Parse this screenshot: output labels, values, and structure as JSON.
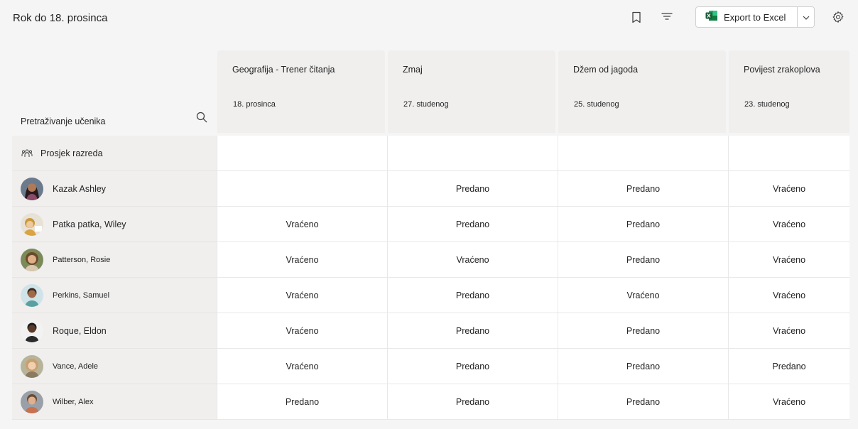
{
  "page": {
    "title": "Rok do 18. prosinca"
  },
  "toolbar": {
    "bookmark_icon": "bookmark-icon",
    "filter_icon": "filter-icon",
    "export_label": "Export to Excel",
    "excel_icon": "excel-icon",
    "dropdown_icon": "chevron-down-icon",
    "settings_icon": "gear-icon"
  },
  "search": {
    "label": "Pretraživanje učenika",
    "icon": "search-icon"
  },
  "assignments": [
    {
      "title": "Geografija - Trener čitanja",
      "date": "18. prosinca"
    },
    {
      "title": "Zmaj",
      "date": "27. studenog"
    },
    {
      "title": "Džem od jagoda",
      "date": "25. studenog"
    },
    {
      "title": "Povijest zrakoplova",
      "date": "23. studenog"
    }
  ],
  "class_average": {
    "label": "Prosjek razreda",
    "icon": "people-icon",
    "values": [
      "",
      "",
      "",
      ""
    ]
  },
  "students": [
    {
      "name": "Kazak Ashley",
      "statuses": [
        "",
        "Predano",
        "Predano",
        "Vraćeno"
      ]
    },
    {
      "name": "Patka patka, Wiley",
      "statuses": [
        "Vraćeno",
        "Predano",
        "Predano",
        "Vraćeno"
      ]
    },
    {
      "name": "Patterson, Rosie",
      "statuses": [
        "Vraćeno",
        "Vraćeno",
        "Predano",
        "Vraćeno"
      ]
    },
    {
      "name": "Perkins, Samuel",
      "statuses": [
        "Vraćeno",
        "Predano",
        "Vraćeno",
        "Vraćeno"
      ]
    },
    {
      "name": "Roque, Eldon",
      "statuses": [
        "Vraćeno",
        "Predano",
        "Predano",
        "Vraćeno"
      ]
    },
    {
      "name": "Vance, Adele",
      "statuses": [
        "Vraćeno",
        "Predano",
        "Predano",
        "Predano"
      ]
    },
    {
      "name": "Wilber, Alex",
      "statuses": [
        "Predano",
        "Predano",
        "Predano",
        "Vraćeno"
      ]
    }
  ],
  "colors": {
    "background": "#f5f5f5",
    "header_bg": "#f0efee",
    "cell_bg": "#ffffff",
    "excel_green": "#107c41"
  }
}
